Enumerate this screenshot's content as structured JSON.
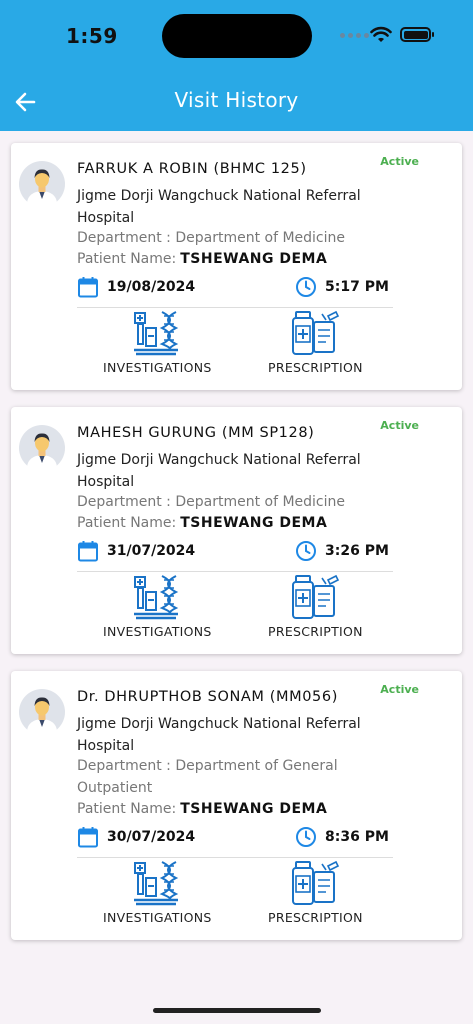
{
  "status_bar": {
    "time": "1:59"
  },
  "header": {
    "title": "Visit History",
    "back_icon": "arrow-left-icon"
  },
  "colors": {
    "header_bg": "#29a9e6",
    "accent": "#1e88e5",
    "active": "#4caf50"
  },
  "labels": {
    "department_prefix": "Department : ",
    "patient_prefix": "Patient Name:",
    "investigations": "INVESTIGATIONS",
    "prescription": "PRESCRIPTION"
  },
  "visits": [
    {
      "doctor": "FARRUK A ROBIN (BHMC 125)",
      "status": "Active",
      "hospital": "Jigme Dorji Wangchuck National Referral Hospital",
      "department": "Department of Medicine",
      "patient": "TSHEWANG  DEMA",
      "date": "19/08/2024",
      "time": "5:17 PM"
    },
    {
      "doctor": "MAHESH  GURUNG (MM SP128)",
      "status": "Active",
      "hospital": "Jigme Dorji Wangchuck National Referral Hospital",
      "department": "Department of Medicine",
      "patient": "TSHEWANG  DEMA",
      "date": "31/07/2024",
      "time": "3:26 PM"
    },
    {
      "doctor": "Dr. DHRUPTHOB SONAM (MM056)",
      "status": "Active",
      "hospital": "Jigme Dorji Wangchuck National Referral Hospital",
      "department": "Department of General Outpatient",
      "patient": "TSHEWANG  DEMA",
      "date": "30/07/2024",
      "time": "8:36 PM"
    }
  ]
}
